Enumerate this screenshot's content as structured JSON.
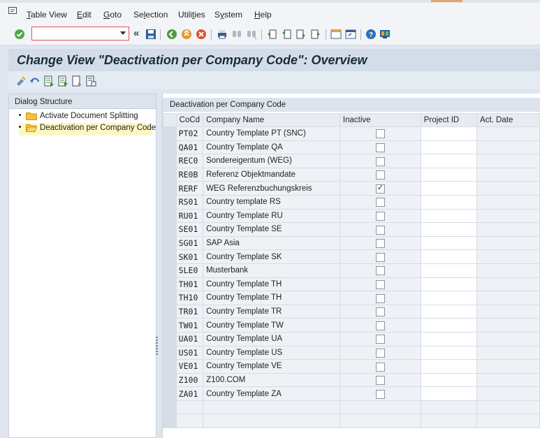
{
  "menu": {
    "items": [
      "Table View",
      "Edit",
      "Goto",
      "Selection",
      "Utilities",
      "System",
      "Help"
    ]
  },
  "toolbar": {
    "command_value": ""
  },
  "title": "Change View \"Deactivation per Company Code\": Overview",
  "dialog_structure": {
    "header": "Dialog Structure",
    "items": [
      {
        "label": "Activate Document Splitting",
        "selected": false
      },
      {
        "label": "Deactivation per Company Code",
        "selected": true
      }
    ]
  },
  "table": {
    "title": "Deactivation per Company Code",
    "columns": [
      "CoCd",
      "Company Name",
      "Inactive",
      "Project ID",
      "Act. Date"
    ],
    "rows": [
      {
        "cocd": "PT02",
        "name": "Country Template PT (SNC)",
        "inactive": false
      },
      {
        "cocd": "QA01",
        "name": "Country Template QA",
        "inactive": false
      },
      {
        "cocd": "REC0",
        "name": "Sondereigentum (WEG)",
        "inactive": false
      },
      {
        "cocd": "RE0B",
        "name": "Referenz Objektmandate",
        "inactive": false
      },
      {
        "cocd": "RERF",
        "name": "WEG Referenzbuchungskreis",
        "inactive": true
      },
      {
        "cocd": "RS01",
        "name": "Country template RS",
        "inactive": false
      },
      {
        "cocd": "RU01",
        "name": "Country Template RU",
        "inactive": false
      },
      {
        "cocd": "SE01",
        "name": "Country Template SE",
        "inactive": false
      },
      {
        "cocd": "SG01",
        "name": "SAP Asia",
        "inactive": false
      },
      {
        "cocd": "SK01",
        "name": "Country Template SK",
        "inactive": false
      },
      {
        "cocd": "SLE0",
        "name": "Musterbank",
        "inactive": false
      },
      {
        "cocd": "TH01",
        "name": "Country Template TH",
        "inactive": false
      },
      {
        "cocd": "TH10",
        "name": "Country Template TH",
        "inactive": false
      },
      {
        "cocd": "TR01",
        "name": "Country Template TR",
        "inactive": false
      },
      {
        "cocd": "TW01",
        "name": "Country Template TW",
        "inactive": false
      },
      {
        "cocd": "UA01",
        "name": "Country Template UA",
        "inactive": false
      },
      {
        "cocd": "US01",
        "name": "Country Template US",
        "inactive": false
      },
      {
        "cocd": "VE01",
        "name": "Country Template VE",
        "inactive": false
      },
      {
        "cocd": "Z100",
        "name": "Z100.COM",
        "inactive": false
      },
      {
        "cocd": "ZA01",
        "name": "Country Template ZA",
        "inactive": false
      }
    ],
    "empty_rows": 2
  },
  "colors": {
    "title_bg": "#d2dde9",
    "selected_tree_bg": "#fdf7c3",
    "folder": "#f2c23a"
  }
}
